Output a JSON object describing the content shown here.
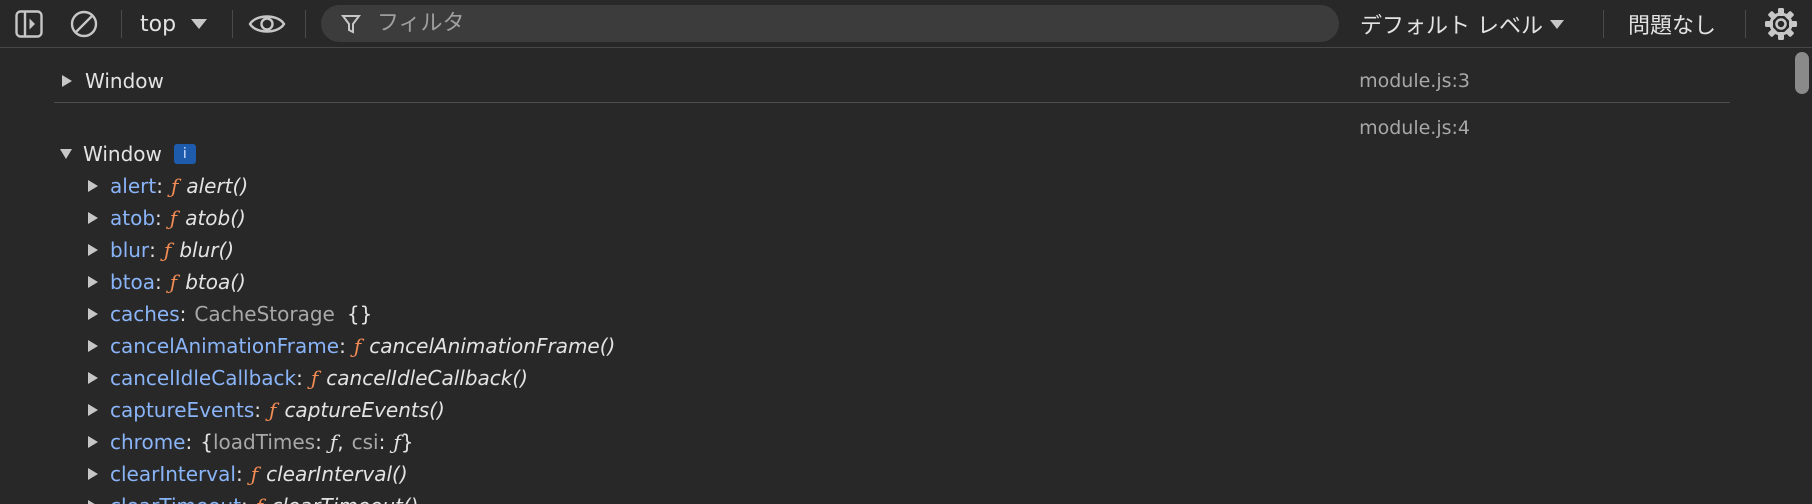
{
  "toolbar": {
    "context_label": "top",
    "filter_placeholder": "フィルタ",
    "level_label": "デフォルト レベル",
    "issues_label": "問題なし"
  },
  "console": {
    "messages": [
      {
        "label": "Window",
        "source": "module.js:3"
      },
      {
        "label": "Window",
        "source": "module.js:4",
        "badge": "i"
      }
    ],
    "properties": [
      {
        "key": "alert",
        "sep": ":",
        "f": "ƒ",
        "name": "alert()"
      },
      {
        "key": "atob",
        "sep": ":",
        "f": "ƒ",
        "name": "atob()"
      },
      {
        "key": "blur",
        "sep": ":",
        "f": "ƒ",
        "name": "blur()"
      },
      {
        "key": "btoa",
        "sep": ":",
        "f": "ƒ",
        "name": "btoa()"
      },
      {
        "key": "caches",
        "sep": ":",
        "class_name": "CacheStorage",
        "value": "{}"
      },
      {
        "key": "cancelAnimationFrame",
        "sep": ":",
        "f": "ƒ",
        "name": "cancelAnimationFrame()"
      },
      {
        "key": "cancelIdleCallback",
        "sep": ":",
        "f": "ƒ",
        "name": "cancelIdleCallback()"
      },
      {
        "key": "captureEvents",
        "sep": ":",
        "f": "ƒ",
        "name": "captureEvents()"
      },
      {
        "key": "chrome",
        "sep": ":",
        "open": "{",
        "k1": "loadTimes",
        "c1": ":",
        "f1": "ƒ",
        "comma": ",",
        "k2": "csi",
        "c2": ":",
        "f2": "ƒ",
        "close": "}"
      },
      {
        "key": "clearInterval",
        "sep": ":",
        "f": "ƒ",
        "name": "clearInterval()"
      },
      {
        "key": "clearTimeout",
        "sep": ":",
        "f": "ƒ",
        "name": "clearTimeout()"
      }
    ]
  },
  "colors": {
    "background": "#282828",
    "property_key": "#8ab4f8",
    "function_symbol": "#f28b54",
    "muted_text": "#a8a8a8",
    "badge": "#1f5bad"
  },
  "icons": [
    "sidebar-toggle-icon",
    "clear-console-icon",
    "dropdown-arrow-icon",
    "eye-icon",
    "filter-icon",
    "settings-gear-icon",
    "disclosure-triangle-icon"
  ]
}
